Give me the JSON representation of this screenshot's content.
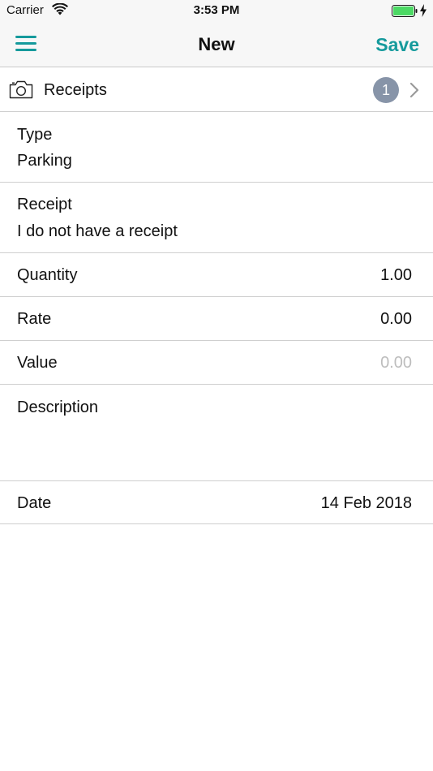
{
  "status_bar": {
    "carrier": "Carrier",
    "time": "3:53 PM",
    "battery_color": "#4cd964"
  },
  "navbar": {
    "title": "New",
    "save_label": "Save",
    "accent_color": "#159a9c"
  },
  "receipts": {
    "label": "Receipts",
    "count": "1"
  },
  "fields": {
    "type": {
      "label": "Type",
      "value": "Parking"
    },
    "receipt": {
      "label": "Receipt",
      "value": "I do not have a receipt"
    },
    "quantity": {
      "label": "Quantity",
      "value": "1.00"
    },
    "rate": {
      "label": "Rate",
      "value": "0.00"
    },
    "value": {
      "label": "Value",
      "value": "0.00"
    },
    "description": {
      "label": "Description",
      "value": ""
    },
    "date": {
      "label": "Date",
      "value": "14 Feb 2018"
    }
  }
}
